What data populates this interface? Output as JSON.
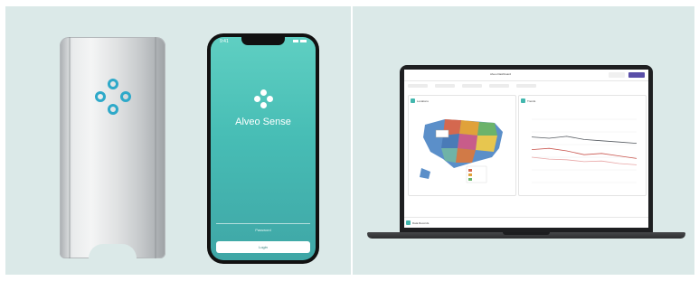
{
  "device": {
    "logo_icon": "four-circle-logo-icon",
    "logo_color": "#2ea9c9"
  },
  "phone": {
    "status_time": "9:41",
    "logo_icon": "four-circle-logo-icon",
    "app_title": "Alveo Sense",
    "input_placeholder": "Password",
    "login_label": "Login"
  },
  "laptop": {
    "dashboard_title": "Alveo Dashboard",
    "map_card_label": "Locations",
    "trend_card_label": "Trends",
    "footer_label": "Data Records",
    "colors": {
      "accent": "#5a4fa8",
      "teal": "#43b7ae",
      "line_red": "#c9554e",
      "line_dark": "#555a60",
      "line_pink": "#e8a6a6"
    }
  },
  "chart_data": {
    "type": "line",
    "series": [
      {
        "values": [
          72,
          70,
          73,
          68,
          66,
          64,
          62
        ]
      },
      {
        "values": [
          52,
          54,
          50,
          44,
          46,
          42,
          38
        ]
      },
      {
        "values": [
          40,
          37,
          36,
          33,
          34,
          30,
          28
        ]
      }
    ],
    "ylim": [
      0,
      100
    ]
  }
}
